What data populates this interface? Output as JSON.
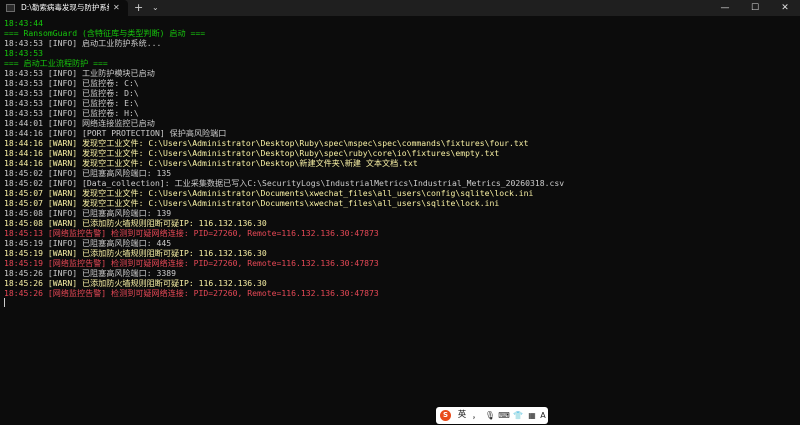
{
  "window": {
    "tab_title": "D:\\勒索病毒发现与防护系统\\",
    "tab_close": "✕",
    "new_tab": "+",
    "tab_dropdown": "⌄",
    "minimize": "—",
    "maximize": "☐",
    "close": "✕"
  },
  "terminal": {
    "lines": [
      {
        "text": "18:43:44",
        "level": "green"
      },
      {
        "text": "=== RansomGuard (含特征库与类型判断) 启动 ===",
        "level": "green"
      },
      {
        "text": "18:43:53 [INFO] 启动工业防护系统...",
        "level": "info"
      },
      {
        "text": "18:43:53",
        "level": "green"
      },
      {
        "text": "=== 启动工业流程防护 ===",
        "level": "green"
      },
      {
        "text": "18:43:53 [INFO] 工业防护模块已启动",
        "level": "info"
      },
      {
        "text": "18:43:53 [INFO] 已监控卷: C:\\",
        "level": "info"
      },
      {
        "text": "18:43:53 [INFO] 已监控卷: D:\\",
        "level": "info"
      },
      {
        "text": "18:43:53 [INFO] 已监控卷: E:\\",
        "level": "info"
      },
      {
        "text": "18:43:53 [INFO] 已监控卷: H:\\",
        "level": "info"
      },
      {
        "text": "18:44:01 [INFO] 网络连接监控已启动",
        "level": "info"
      },
      {
        "text": "18:44:16 [INFO] [PORT PROTECTION] 保护高风险端口",
        "level": "info"
      },
      {
        "text": "18:44:16 [WARN] 发现空工业文件: C:\\Users\\Administrator\\Desktop\\Ruby\\spec\\mspec\\spec\\commands\\fixtures\\four.txt",
        "level": "warn"
      },
      {
        "text": "18:44:16 [WARN] 发现空工业文件: C:\\Users\\Administrator\\Desktop\\Ruby\\spec\\ruby\\core\\io\\fixtures\\empty.txt",
        "level": "warn"
      },
      {
        "text": "18:44:16 [WARN] 发现空工业文件: C:\\Users\\Administrator\\Desktop\\新建文件夹\\新建 文本文档.txt",
        "level": "warn"
      },
      {
        "text": "18:45:02 [INFO] 已阻塞高风险端口: 135",
        "level": "info"
      },
      {
        "text": "18:45:02 [INFO] [Data_collection]: 工业采集数据已写入C:\\SecurityLogs\\IndustrialMetrics\\Industrial_Metrics_20260318.csv",
        "level": "info"
      },
      {
        "text": "18:45:07 [WARN] 发现空工业文件: C:\\Users\\Administrator\\Documents\\xwechat_files\\all_users\\config\\sqlite\\lock.ini",
        "level": "warn"
      },
      {
        "text": "18:45:07 [WARN] 发现空工业文件: C:\\Users\\Administrator\\Documents\\xwechat_files\\all_users\\sqlite\\lock.ini",
        "level": "warn"
      },
      {
        "text": "18:45:08 [INFO] 已阻塞高风险端口: 139",
        "level": "info"
      },
      {
        "text": "18:45:08 [WARN] 已添加防火墙规则阻断可疑IP: 116.132.136.30",
        "level": "warn"
      },
      {
        "text": "18:45:13 [网络监控告警] 检测到可疑网络连接: PID=27260, Remote=116.132.136.30:47873",
        "level": "alert"
      },
      {
        "text": "18:45:19 [INFO] 已阻塞高风险端口: 445",
        "level": "info"
      },
      {
        "text": "18:45:19 [WARN] 已添加防火墙规则阻断可疑IP: 116.132.136.30",
        "level": "warn"
      },
      {
        "text": "18:45:19 [网络监控告警] 检测到可疑网络连接: PID=27260, Remote=116.132.136.30:47873",
        "level": "alert"
      },
      {
        "text": "18:45:26 [INFO] 已阻塞高风险端口: 3389",
        "level": "info"
      },
      {
        "text": "18:45:26 [WARN] 已添加防火墙规则阻断可疑IP: 116.132.136.30",
        "level": "warn"
      },
      {
        "text": "18:45:26 [网络监控告警] 检测到可疑网络连接: PID=27260, Remote=116.132.136.30:47873",
        "level": "alert"
      }
    ]
  },
  "ime": {
    "logo": "S",
    "lang": "英",
    "punct": "，",
    "mic": "🎙",
    "keyboard": "⌨",
    "skin": "👕",
    "tools": "▦",
    "ai": "A"
  },
  "colors": {
    "background": "#0c0c0c",
    "green": "#16c60c",
    "info": "#cccccc",
    "warn": "#f9f1a5",
    "alert": "#e74856"
  }
}
